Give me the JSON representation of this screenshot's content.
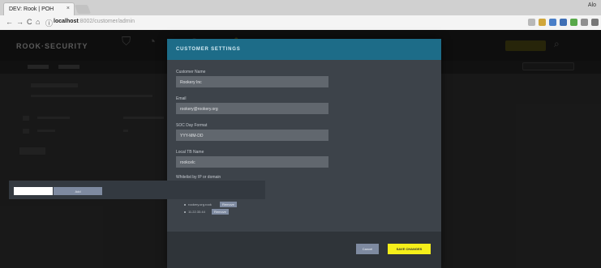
{
  "browser": {
    "tab_title": "DEV: Rook | POH",
    "tab_close": "×",
    "profile_label": "Alo",
    "url_host": "localhost",
    "url_path": ":8002/customer/admin",
    "nav": {
      "back": "←",
      "forward": "→",
      "reload": "C",
      "home": "⌂",
      "info": "ⓘ"
    }
  },
  "app": {
    "brand": "ROOK·SECURITY",
    "nav_icons": [
      "shield-icon",
      "gauge-icon",
      "user-icon",
      "gear-icon"
    ],
    "hdr_search_glyph": "⌕"
  },
  "modal": {
    "title": "CUSTOMER SETTINGS",
    "fields": [
      {
        "label": "Customer Name",
        "value": "Rookery Inc"
      },
      {
        "label": "Email",
        "value": "rookery@rookery.org"
      },
      {
        "label": "SOC Day Format",
        "value": "YYY-MM-DD"
      },
      {
        "label": "Local TB Name",
        "value": "rookcelc"
      }
    ],
    "whitelist": {
      "label": "Whitelist by IP or domain",
      "input_value": "",
      "add_label": "Add",
      "items": [
        {
          "text": "rookery.org.rook",
          "remove_label": "Remove"
        },
        {
          "text": "11.22.33.44",
          "remove_label": "Remove"
        }
      ]
    },
    "cancel_label": "Cancel",
    "save_label": "SAVE CHANGES"
  },
  "colors": {
    "modal_header": "#1d6c88",
    "modal_body": "#3d434a",
    "save_button": "#f5ef1a",
    "secondary_button": "#7e8aa0"
  }
}
